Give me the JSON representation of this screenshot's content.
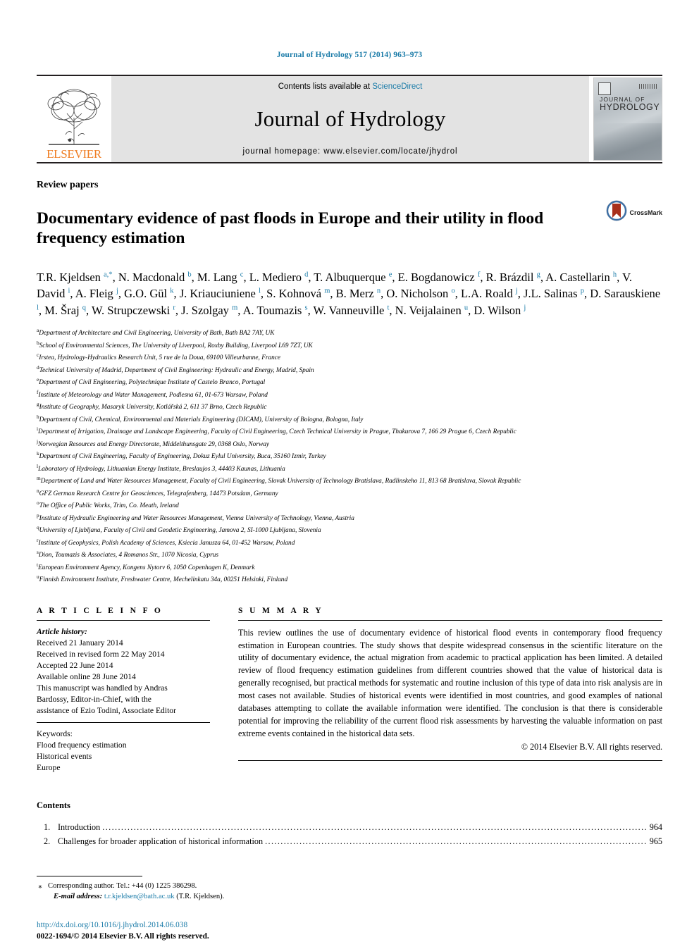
{
  "running_head": "Journal of Hydrology 517 (2014) 963–973",
  "banner": {
    "publisher": "ELSEVIER",
    "contents_prefix": "Contents lists available at ",
    "sciencedirect": "ScienceDirect",
    "journal_name": "Journal of Hydrology",
    "homepage": "journal homepage: www.elsevier.com/locate/jhydrol",
    "cover_title_line1": "JOURNAL OF",
    "cover_title_line2": "HYDROLOGY"
  },
  "article": {
    "section_type": "Review papers",
    "title": "Documentary evidence of past floods in Europe and their utility in flood frequency estimation",
    "crossmark_label": "CrossMark"
  },
  "authors_html": "T.R. Kjeldsen <sup>a,*</sup>, N. Macdonald <sup>b</sup>, M. Lang <sup>c</sup>, L. Mediero <sup>d</sup>, T. Albuquerque <sup>e</sup>, E. Bogdanowicz <sup>f</sup>, R. Brázdil <sup>g</sup>, A. Castellarin <sup>h</sup>, V. David <sup>i</sup>, A. Fleig <sup>j</sup>, G.O. Gül <sup>k</sup>, J. Kriauciuniene <sup>l</sup>, S. Kohnová <sup>m</sup>, B. Merz <sup>n</sup>, O. Nicholson <sup>o</sup>, L.A. Roald <sup>j</sup>, J.L. Salinas <sup>p</sup>, D. Sarauskiene <sup>l</sup>, M. Šraj <sup>q</sup>, W. Strupczewski <sup>r</sup>, J. Szolgay <sup>m</sup>, A. Toumazis <sup>s</sup>, W. Vanneuville <sup>t</sup>, N. Veijalainen <sup>u</sup>, D. Wilson <sup>j</sup>",
  "affiliations": [
    {
      "mark": "a",
      "text": "Department of Architecture and Civil Engineering, University of Bath, Bath BA2 7AY, UK"
    },
    {
      "mark": "b",
      "text": "School of Environmental Sciences, The University of Liverpool, Roxby Building, Liverpool L69 7ZT, UK"
    },
    {
      "mark": "c",
      "text": "Irstea, Hydrology-Hydraulics Research Unit, 5 rue de la Doua, 69100 Villeurbanne, France"
    },
    {
      "mark": "d",
      "text": "Technical University of Madrid, Department of Civil Engineering: Hydraulic and Energy, Madrid, Spain"
    },
    {
      "mark": "e",
      "text": "Department of Civil Engineering, Polytechnique Institute of Castelo Branco, Portugal"
    },
    {
      "mark": "f",
      "text": "Institute of Meteorology and Water Management, Podlesna 61, 01-673 Warsaw, Poland"
    },
    {
      "mark": "g",
      "text": "Institute of Geography, Masaryk University, Kotlářská 2, 611 37 Brno, Czech Republic"
    },
    {
      "mark": "h",
      "text": "Department of Civil, Chemical, Environmental and Materials Engineering (DICAM), University of Bologna, Bologna, Italy"
    },
    {
      "mark": "i",
      "text": "Department of Irrigation, Drainage and Landscape Engineering, Faculty of Civil Engineering, Czech Technical University in Prague, Thakurova 7, 166 29 Prague 6, Czech Republic"
    },
    {
      "mark": "j",
      "text": "Norwegian Resources and Energy Directorate, Middelthunsgate 29, 0368 Oslo, Norway"
    },
    {
      "mark": "k",
      "text": "Department of Civil Engineering, Faculty of Engineering, Dokuz Eylul University, Buca, 35160 Izmir, Turkey"
    },
    {
      "mark": "l",
      "text": "Laboratory of Hydrology, Lithuanian Energy Institute, Breslaujos 3, 44403 Kaunas, Lithuania"
    },
    {
      "mark": "m",
      "text": "Department of Land and Water Resources Management, Faculty of Civil Engineering, Slovak University of Technology Bratislava, Radlinskeho 11, 813 68 Bratislava, Slovak Republic"
    },
    {
      "mark": "n",
      "text": "GFZ German Research Centre for Geosciences, Telegrafenberg, 14473 Potsdam, Germany"
    },
    {
      "mark": "o",
      "text": "The Office of Public Works, Trim, Co. Meath, Ireland"
    },
    {
      "mark": "p",
      "text": "Institute of Hydraulic Engineering and Water Resources Management, Vienna University of Technology, Vienna, Austria"
    },
    {
      "mark": "q",
      "text": "University of Ljubljana, Faculty of Civil and Geodetic Engineering, Jamova 2, SI-1000 Ljubljana, Slovenia"
    },
    {
      "mark": "r",
      "text": "Institute of Geophysics, Polish Academy of Sciences, Ksiecia Janusza 64, 01-452 Warsaw, Poland"
    },
    {
      "mark": "s",
      "text": "Dion, Toumazis & Associates, 4 Romanos Str., 1070 Nicosia, Cyprus"
    },
    {
      "mark": "t",
      "text": "European Environment Agency, Kongens Nytorv 6, 1050 Copenhagen K, Denmark"
    },
    {
      "mark": "u",
      "text": "Finnish Environment Institute, Freshwater Centre, Mechelinkatu 34a, 00251 Helsinki, Finland"
    }
  ],
  "article_info": {
    "heading": "A R T I C L E    I N F O",
    "history_label": "Article history:",
    "history": [
      "Received 21 January 2014",
      "Received in revised form 22 May 2014",
      "Accepted 22 June 2014",
      "Available online 28 June 2014",
      "This manuscript was handled by Andras",
      "Bardossy, Editor-in-Chief, with the",
      "assistance of Ezio Todini, Associate Editor"
    ],
    "keywords_label": "Keywords:",
    "keywords": [
      "Flood frequency estimation",
      "Historical events",
      "Europe"
    ]
  },
  "summary": {
    "heading": "S U M M A R Y",
    "text": "This review outlines the use of documentary evidence of historical flood events in contemporary flood frequency estimation in European countries. The study shows that despite widespread consensus in the scientific literature on the utility of documentary evidence, the actual migration from academic to practical application has been limited. A detailed review of flood frequency estimation guidelines from different countries showed that the value of historical data is generally recognised, but practical methods for systematic and routine inclusion of this type of data into risk analysis are in most cases not available. Studies of historical events were identified in most countries, and good examples of national databases attempting to collate the available information were identified. The conclusion is that there is considerable potential for improving the reliability of the current flood risk assessments by harvesting the valuable information on past extreme events contained in the historical data sets.",
    "copyright": "© 2014 Elsevier B.V. All rights reserved."
  },
  "contents": {
    "heading": "Contents",
    "entries": [
      {
        "num": "1.",
        "label": "Introduction",
        "page": "964"
      },
      {
        "num": "2.",
        "label": "Challenges for broader application of historical information",
        "page": "965"
      }
    ]
  },
  "footnotes": {
    "corresponding_mark": "⁎",
    "corresponding": "Corresponding author. Tel.: +44 (0) 1225 386298.",
    "email_label": "E-mail address:",
    "email": "t.r.kjeldsen@bath.ac.uk",
    "email_suffix": "(T.R. Kjeldsen)."
  },
  "footer": {
    "doi": "http://dx.doi.org/10.1016/j.jhydrol.2014.06.038",
    "issn": "0022-1694/© 2014 Elsevier B.V. All rights reserved."
  },
  "colors": {
    "link_blue": "#1a7ba8",
    "elsevier_orange": "#ef7d23",
    "banner_grey": "#e3e3e3",
    "crossmark_red": "#a8301c"
  }
}
